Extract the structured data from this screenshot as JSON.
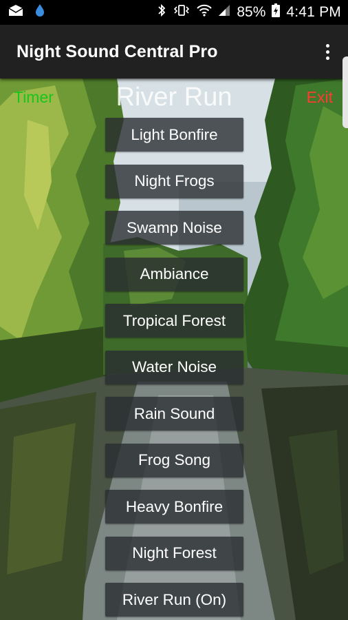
{
  "status_bar": {
    "battery_percent": "85%",
    "time": "4:41 PM",
    "left_icons": [
      "mail-icon",
      "water-drop-icon"
    ],
    "right_icons": [
      "bluetooth-icon",
      "vibrate-icon",
      "wifi-icon",
      "signal-icon",
      "battery-charging-icon"
    ]
  },
  "toolbar": {
    "title": "Night Sound Central Pro",
    "overflow_icon": "overflow-menu-icon"
  },
  "header": {
    "timer_label": "Timer",
    "exit_label": "Exit",
    "current_sound": "River Run"
  },
  "sounds": [
    "Light Bonfire",
    "Night Frogs",
    "Swamp Noise",
    "Ambiance",
    "Tropical Forest",
    "Water Noise",
    "Rain Sound",
    "Frog Song",
    "Heavy Bonfire",
    "Night Forest",
    "River Run (On)"
  ],
  "colors": {
    "timer": "#19c519",
    "exit": "#ff3b30",
    "toolbar": "#212121",
    "button_bg": "#282c30"
  }
}
